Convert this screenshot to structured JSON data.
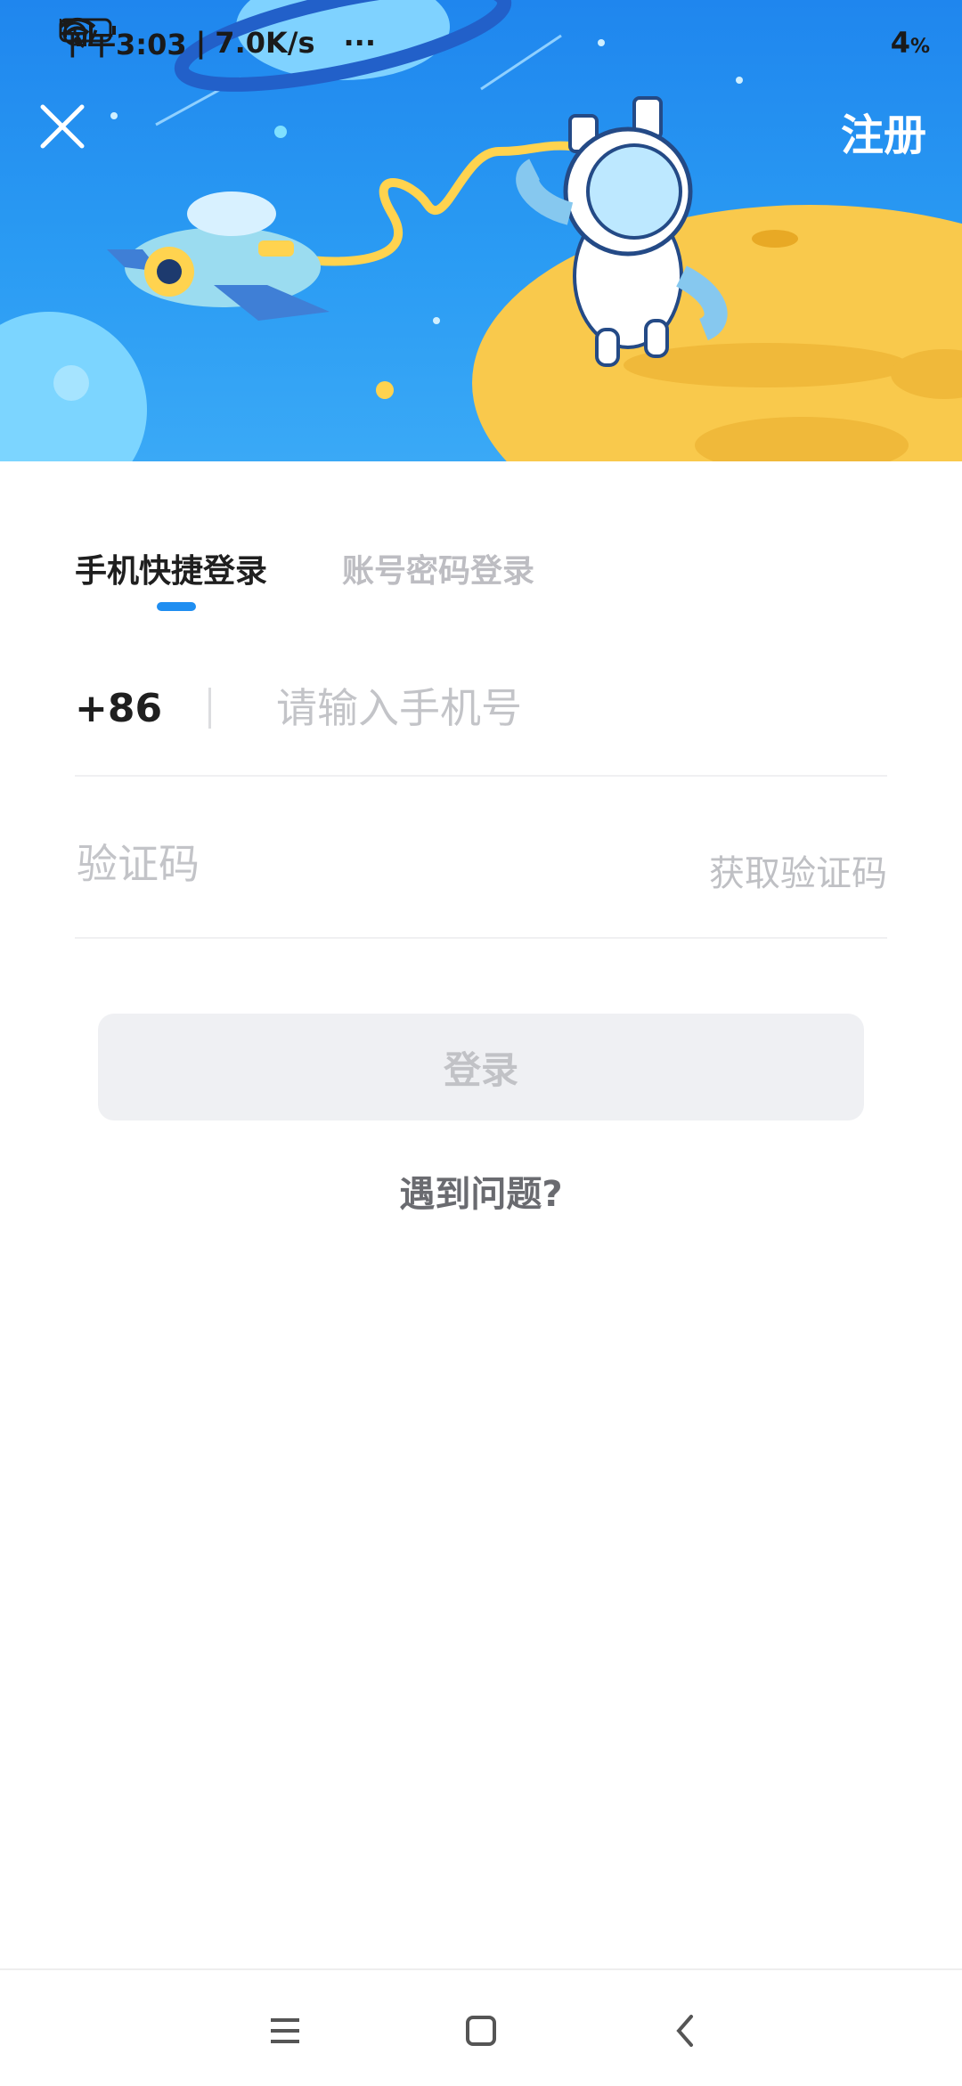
{
  "status_bar": {
    "time": "下午3:03",
    "speed": "7.0K/s",
    "more": "···",
    "battery": "4",
    "battery_unit": "%",
    "network_1": "HD",
    "network_2": "HD"
  },
  "header": {
    "close_icon": "close-icon",
    "register_label": "注册"
  },
  "tabs": [
    {
      "label": "手机快捷登录",
      "active": true
    },
    {
      "label": "账号密码登录",
      "active": false
    }
  ],
  "phone": {
    "country_code": "+86",
    "placeholder": "请输入手机号"
  },
  "verification": {
    "placeholder": "验证码",
    "get_code_label": "获取验证码"
  },
  "login_button_label": "登录",
  "help_link": "遇到问题?",
  "colors": {
    "accent": "#1f8ef1",
    "hero_top": "#1f86ee",
    "moon": "#f9c94c"
  },
  "nav_icons": [
    "menu-icon",
    "home-icon",
    "back-icon"
  ]
}
